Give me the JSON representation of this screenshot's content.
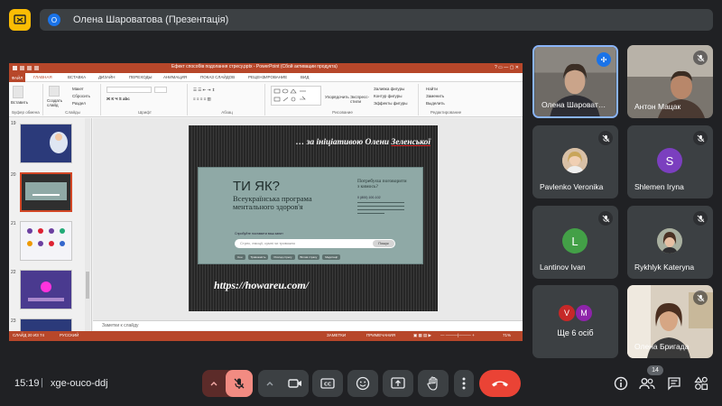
{
  "top": {
    "presenter_title": "Олена Шароватова (Презентація)",
    "presenter_initial": "О"
  },
  "ppt": {
    "window_title": "Ефект способів подолання стресу.pptx - PowerPoint (Сбой активации продукта)",
    "tabs": [
      "ФАЙЛ",
      "ГЛАВНАЯ",
      "ВСТАВКА",
      "ДИЗАЙН",
      "ПЕРЕХОДЫ",
      "АНИМАЦИЯ",
      "ПОКАЗ СЛАЙДОВ",
      "РЕЦЕНЗИРОВАНИЕ",
      "ВИД"
    ],
    "ribbon": {
      "paste": "Вставить",
      "new_slide": "Создать слайд",
      "layout": "Макет",
      "reset": "Сбросить",
      "section": "Раздел",
      "group_clipboard": "Буфер обмена",
      "group_slides": "Слайды",
      "group_font": "Шрифт",
      "group_paragraph": "Абзац",
      "group_drawing": "Рисование",
      "group_editing": "Редактирование",
      "arrange": "Упорядочить",
      "quick_styles": "Экспресс-стили",
      "shape_fill": "Заливка фигуры",
      "shape_outline": "Контур фигуры",
      "shape_effects": "Эффекты фигуры",
      "find": "Найти",
      "replace": "Заменить",
      "select": "Выделить"
    },
    "thumbs": [
      "19",
      "20",
      "21",
      "22",
      "23"
    ],
    "slide": {
      "caption_prefix": "… за ініціативою Олени ",
      "caption_name": "Зеленської",
      "logo": "ТИ ЯК?",
      "program": "Всеукраїнська програма ментального здоров'я",
      "right_text": "Потребуєш поговорити з кимось?",
      "phone": "0 (800) 100-102",
      "ask": "Спробуйте поставити ваш запит",
      "search_placeholder": "Стрес, емоції, сумні чи тривожно",
      "search_btn": "Пошук",
      "chips": [
        "Сон",
        "Тривожність",
        "Розлад стресу",
        "Вплив страху",
        "Медитації"
      ],
      "url": "https://howareu.com/"
    },
    "notes": "Заметки к слайду",
    "status": {
      "slide": "СЛАЙД 20 ИЗ 74",
      "lang": "РУССКИЙ",
      "notes_btn": "ЗАМЕТКИ",
      "comments_btn": "ПРИМЕЧАНИЯ",
      "zoom": "71%"
    }
  },
  "participants": [
    {
      "name": "Олена Шароват…",
      "type": "video",
      "active": true,
      "muted": false
    },
    {
      "name": "Антон Мацак",
      "type": "video",
      "muted": true
    },
    {
      "name": "Pavlenko Veronika",
      "type": "photo",
      "muted": true
    },
    {
      "name": "Shlemen Iryna",
      "type": "letter",
      "letter": "S",
      "color": "#7b3fbf",
      "muted": true
    },
    {
      "name": "Lantinov Ivan",
      "type": "letter",
      "letter": "L",
      "color": "#43a047",
      "muted": true
    },
    {
      "name": "Rykhlyk Kateryna",
      "type": "photo",
      "muted": true
    },
    {
      "name": "Ще 6 осіб",
      "type": "more",
      "letters": [
        "V",
        "M"
      ]
    },
    {
      "name": "Олена Бригада",
      "type": "video",
      "muted": true
    }
  ],
  "bottom": {
    "time": "15:19",
    "meeting_code": "xge-ouco-ddj",
    "participant_count": "14"
  },
  "colors": {
    "accent_red": "#ea4335",
    "ppt_red": "#b7472a",
    "present_yellow": "#fbbc04"
  }
}
